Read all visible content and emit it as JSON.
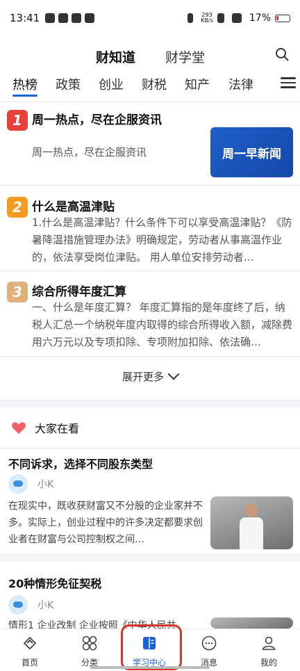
{
  "status_bar": {
    "time": "13:41",
    "net_speed_value": "293",
    "net_speed_unit": "KB/s",
    "battery": "17%"
  },
  "top_tabs": [
    "财知道",
    "财学堂"
  ],
  "categories": [
    "热榜",
    "政策",
    "创业",
    "财税",
    "知产",
    "法律"
  ],
  "hot_list": [
    {
      "rank": "1",
      "title": "周一热点，尽在企服资讯",
      "summary": "周一热点，尽在企服资讯",
      "thumb_text": "周一早新闻",
      "rank_color": "#e8403a"
    },
    {
      "rank": "2",
      "title": "什么是高温津贴",
      "summary": "1.什么是高温津贴？什么条件下可以享受高温津贴？《防暑降温措施管理办法》明确规定，劳动者从事高温作业的，依法享受岗位津贴。 用人单位安排劳动者…",
      "rank_color": "#f59a23"
    },
    {
      "rank": "3",
      "title": "综合所得年度汇算",
      "summary": "一、什么是年度汇算？ 年度汇算指的是年度终了后，纳税人汇总一个纳税年度内取得的综合所得收入额，减除费用六万元以及专项扣除、专项附加扣除、依法确…",
      "rank_color": "#e0b07a"
    }
  ],
  "expand_label": "展开更多",
  "section_title": "大家在看",
  "articles": [
    {
      "title": "不同诉求，选择不同股东类型",
      "author": "小K",
      "summary": "在现实中，既收获财富又不分股的企业家并不多。实际上，创业过程中的许多决定都要求创业者在财富与公司控制权之间…"
    },
    {
      "title": "20种情形免征契税",
      "author": "小K",
      "summary": "情形1 企业改制 企业按照《中华人民共"
    }
  ],
  "tab_bar": [
    "首页",
    "分类",
    "学习中心",
    "消息",
    "我的"
  ],
  "accent_color": "#1a62d8"
}
